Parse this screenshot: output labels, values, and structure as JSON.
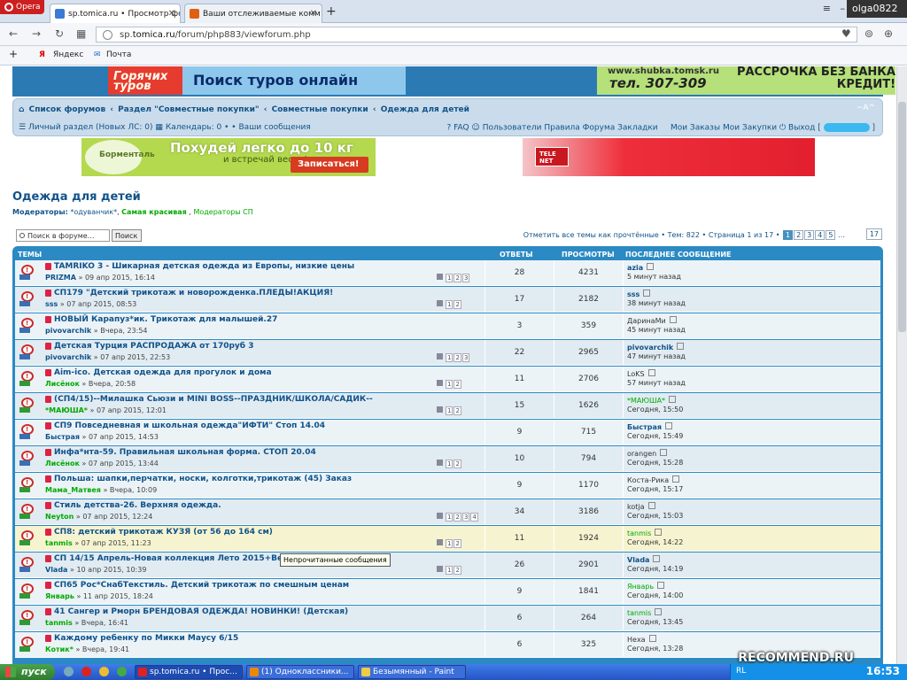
{
  "browser": {
    "menu_label": "Opera",
    "tabs": [
      {
        "title": "sp.tomica.ru • Просмотр фор",
        "active": true
      },
      {
        "title": "Ваши отслеживаемые комм",
        "active": false
      }
    ],
    "user": "olga0822",
    "url_prefix": "sp.",
    "url_host": "tomica.ru",
    "url_path": "/forum/php883/viewforum.php",
    "bookmarks": [
      "Яндекс",
      "Почта"
    ]
  },
  "banners": {
    "top_left_red": "Горячих туров",
    "top_left_text": "Поиск туров онлайн",
    "top_right_site": "www.shubka.tomsk.ru",
    "top_right_phone": "тел. 307-309",
    "top_right_offer": "РАССРОЧКА БЕЗ БАНКА КРЕДИТ!",
    "mid_left_brand": "Борменталь",
    "mid_left_title": "Похудей легко до 10 кг",
    "mid_left_sub": "и встречай весну!",
    "mid_left_button": "Записаться!",
    "mid_right_logo": "TELE NET"
  },
  "nav": {
    "crumbs": [
      "Список форумов",
      "Раздел \"Совместные покупки\"",
      "Совместные покупки",
      "Одежда для детей"
    ],
    "crumb_sep": "‹",
    "az": "~A^",
    "personal": "Личный раздел (Новых ЛС: 0)",
    "calendar": "Календарь: 0",
    "messages": "• • Ваши сообщения",
    "faq": "FAQ",
    "users": "Пользователи",
    "rules": "Правила Форума",
    "bookmarks": "Закладки",
    "my_orders": "Мои Заказы",
    "my_purchases": "Мои Закупки",
    "logout": "Выход [",
    "logout_end": "]"
  },
  "forum": {
    "title": "Одежда для детей",
    "moderators_label": "Модераторы:",
    "moderators": [
      "*одуванчик*",
      "Самая красивая",
      "Модераторы СП"
    ],
    "search_placeholder": "Поиск в форуме…",
    "search_button": "Поиск",
    "mark_read": "Отметить все темы как прочтённые",
    "topics_count": "Тем: 822",
    "page_info": "Страница 1 из 17",
    "pages": [
      "1",
      "2",
      "3",
      "4",
      "5"
    ],
    "ellipsis": "…",
    "last_page": "17"
  },
  "table": {
    "headers": {
      "topics": "ТЕМЫ",
      "replies": "ОТВЕТЫ",
      "views": "ПРОСМОТРЫ",
      "last": "ПОСЛЕДНЕЕ СООБЩЕНИЕ"
    },
    "rows": [
      {
        "title": "TAMRIKO 3 - Шикарная детская одежда из Европы, низкие цены",
        "author": "PRIZMA",
        "date": "» 09 апр 2015, 16:14",
        "pages": [
          "1",
          "2",
          "3"
        ],
        "replies": "28",
        "views": "4231",
        "last_author": "azia",
        "last_time": "5 минут назад",
        "green": false
      },
      {
        "title": "СП179 \"Детский трикотаж и новорожденка.ПЛЕДЫ!АКЦИЯ!",
        "author": "sss",
        "date": "» 07 апр 2015, 08:53",
        "pages": [
          "1",
          "2"
        ],
        "replies": "17",
        "views": "2182",
        "last_author": "sss",
        "last_time": "38 минут назад",
        "green": false
      },
      {
        "title": "НОВЫЙ Карапуз*ик. Трикотаж для малышей.27",
        "author": "pivovarchik",
        "date": "» Вчера, 23:54",
        "pages": [],
        "replies": "3",
        "views": "359",
        "last_author": "ДаринаМи",
        "last_time": "45 минут назад",
        "green": false
      },
      {
        "title": "Детская Турция РАСПРОДАЖА от 170руб 3",
        "author": "pivovarchik",
        "date": "» 07 апр 2015, 22:53",
        "pages": [
          "1",
          "2",
          "3"
        ],
        "replies": "22",
        "views": "2965",
        "last_author": "pivovarchik",
        "last_time": "47 минут назад",
        "green": false
      },
      {
        "title": "Aim-ico. Детская одежда для прогулок и дома",
        "author": "Лисёнок",
        "date": "» Вчера, 20:58",
        "pages": [
          "1",
          "2"
        ],
        "replies": "11",
        "views": "2706",
        "last_author": "LoKS",
        "last_time": "57 минут назад",
        "green": true
      },
      {
        "title": "(СП4/15)--Милашка Сьюзи и MINI BOSS--ПРАЗДНИК/ШКОЛА/САДИК--",
        "author": "*МАЮША*",
        "date": "» 07 апр 2015, 12:01",
        "pages": [
          "1",
          "2"
        ],
        "replies": "15",
        "views": "1626",
        "last_author": "*МАЮША*",
        "last_time": "Сегодня, 15:50",
        "green": true
      },
      {
        "title": "СП9 Повседневная и школьная одежда\"ИФТИ\" Стоп 14.04",
        "author": "Быстрая",
        "date": "» 07 апр 2015, 14:53",
        "pages": [],
        "replies": "9",
        "views": "715",
        "last_author": "Быстрая",
        "last_time": "Сегодня, 15:49",
        "green": false
      },
      {
        "title": "Инфа*нта-59. Правильная школьная форма. СТОП 20.04",
        "author": "Лисёнок",
        "date": "» 07 апр 2015, 13:44",
        "pages": [
          "1",
          "2"
        ],
        "replies": "10",
        "views": "794",
        "last_author": "orangen",
        "last_time": "Сегодня, 15:28",
        "green": false
      },
      {
        "title": "Польша: шапки,перчатки, носки, колготки,трикотаж (45) Заказ",
        "author": "Мама_Матвея",
        "date": "» Вчера, 10:09",
        "pages": [],
        "replies": "9",
        "views": "1170",
        "last_author": "Коста-Рика",
        "last_time": "Сегодня, 15:17",
        "green": true
      },
      {
        "title": "Стиль детства-26. Верхняя одежда.",
        "author": "Neyton",
        "date": "» 07 апр 2015, 12:24",
        "pages": [
          "1",
          "2",
          "3",
          "4"
        ],
        "replies": "34",
        "views": "3186",
        "last_author": "kotja",
        "last_time": "Сегодня, 15:03",
        "green": true
      },
      {
        "title": "СП8: детский трикотаж КУЗЯ (от 56 до 164 см)",
        "author": "tanmis",
        "date": "» 07 апр 2015, 11:23",
        "pages": [
          "1",
          "2"
        ],
        "replies": "11",
        "views": "1924",
        "last_author": "tanmis",
        "last_time": "Сегодня, 14:22",
        "green": true
      },
      {
        "title": "СП 14/15 Апрель-Новая коллекция Лето 2015+Весенняя распродаж",
        "author": "Vlada",
        "date": "» 10 апр 2015, 10:39",
        "pages": [
          "1",
          "2"
        ],
        "replies": "26",
        "views": "2901",
        "last_author": "Vlada",
        "last_time": "Сегодня, 14:19",
        "green": false
      },
      {
        "title": "СП65 Рос*СнабТекстиль. Детский трикотаж по смешным ценам",
        "author": "Январь",
        "date": "» 11 апр 2015, 18:24",
        "pages": [],
        "replies": "9",
        "views": "1841",
        "last_author": "Январь",
        "last_time": "Сегодня, 14:00",
        "green": true
      },
      {
        "title": "41 Сангер и Рморн БРЕНДОВАЯ ОДЕЖДА! НОВИНКИ! (Детская)",
        "author": "tanmis",
        "date": "» Вчера, 16:41",
        "pages": [],
        "replies": "6",
        "views": "264",
        "last_author": "tanmis",
        "last_time": "Сегодня, 13:45",
        "green": true
      },
      {
        "title": "Каждому ребенку по Микки Маусу 6/15",
        "author": "Котик*",
        "date": "» Вчера, 19:41",
        "pages": [],
        "replies": "6",
        "views": "325",
        "last_author": "Неха",
        "last_time": "Сегодня, 13:28",
        "green": true
      }
    ]
  },
  "tooltip": "Непрочитанные сообщения",
  "taskbar": {
    "start": "пуск",
    "tasks": [
      "sp.tomica.ru • Прос...",
      "(1) Одноклассники...",
      "Безымянный - Paint"
    ],
    "lang": "RL",
    "clock": "16:53",
    "watermark": "RECOMMEND.RU"
  },
  "colors": {
    "link": "#105289",
    "header": "#2b8ac3",
    "row": "#ecf3f7",
    "row_alt": "#e1ebf2",
    "highlight": "#f6f4d0",
    "green_user": "#00aa00"
  }
}
